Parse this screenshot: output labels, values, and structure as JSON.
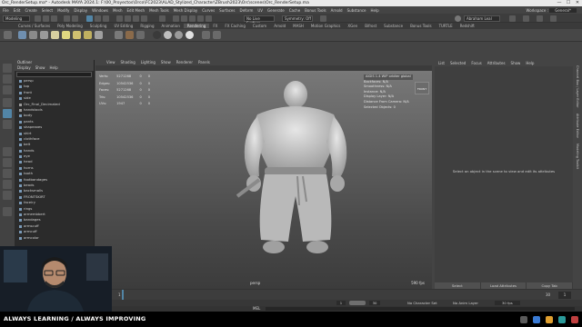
{
  "window": {
    "title": "Orc_RenderSetup.ma* - Autodesk MAYA 2024.1: F:\\00_Proyectos\\Orco\\FC2023\\ALAD_Stylized_Character\\ZBrush2023\\Orc\\scenes\\Orc_RenderSetup.ma",
    "minimize": "—",
    "maximize": "☐",
    "close": "✕"
  },
  "menu": {
    "items": [
      "File",
      "Edit",
      "Create",
      "Select",
      "Modify",
      "Display",
      "Windows",
      "Mesh",
      "Edit Mesh",
      "Mesh Tools",
      "Mesh Display",
      "Curves",
      "Surfaces",
      "Deform",
      "UV",
      "Generate",
      "Cache",
      "Bonus Tools",
      "Arnold",
      "Substance",
      "Help"
    ],
    "workspace_label": "Workspace :",
    "workspace_value": "General*"
  },
  "status_line": {
    "mode": "Modeling",
    "no_live_surface": "No Live Surface",
    "symmetry": "Symmetry: Off",
    "user": "Abraham Leal",
    "signin": "Sign In"
  },
  "shelf": {
    "tabs": [
      "Curves / Surfaces",
      "Poly Modeling",
      "Sculpting",
      "UV Editing",
      "Rigging",
      "Animation",
      "Rendering",
      "FX",
      "FX Caching",
      "Custom",
      "Arnold",
      "MASH",
      "Motion Graphics",
      "XGen",
      "Bifrost",
      "Substance",
      "Bonus Tools",
      "TURTLE",
      "Redshift"
    ],
    "active_tab": "Rendering"
  },
  "outliner": {
    "title": "Outliner",
    "menu": [
      "Display",
      "Show",
      "Help"
    ],
    "search_placeholder": "Search...",
    "items": [
      "persp",
      "top",
      "front",
      "side",
      "Orc_Final_Decimated",
      "handstools",
      "body",
      "pants",
      "shapeaxes",
      "shirt",
      "clothface",
      "belt",
      "hands",
      "eye",
      "head",
      "horns",
      "tooth",
      "footbandages",
      "beads",
      "backsmalls",
      "FRONTSKIRT",
      "faceiry",
      "rings",
      "armembbert",
      "bandages",
      "armscuff",
      "armcuff",
      "armcolor"
    ]
  },
  "viewport": {
    "menu": [
      "View",
      "Shading",
      "Lighting",
      "Show",
      "Renderer",
      "Panels"
    ],
    "hud_left": [
      {
        "label": "Verts:",
        "values": [
          "5271268",
          "0",
          "0"
        ]
      },
      {
        "label": "Edges:",
        "values": [
          "10542536",
          "0",
          "0"
        ]
      },
      {
        "label": "Faces:",
        "values": [
          "5271268",
          "0",
          "0"
        ]
      },
      {
        "label": "Tris:",
        "values": [
          "10542536",
          "0",
          "0"
        ]
      },
      {
        "label": "UVs:",
        "values": [
          "1947",
          "0",
          "0"
        ]
      }
    ],
    "hud_right_header": "AIGIS 1.4 WIP orbiter global",
    "hud_right": [
      {
        "label": "Backfaces:",
        "value": "N/A"
      },
      {
        "label": "Smoothness:",
        "value": "N/A"
      },
      {
        "label": "Instance:",
        "value": "N/A"
      },
      {
        "label": "Display Layer:",
        "value": "N/A"
      },
      {
        "label": "Distance From Camera:",
        "value": "N/A"
      },
      {
        "label": "Selected Objects:",
        "value": "0"
      }
    ],
    "view_cube": "FRONT",
    "camera": "persp",
    "fps": "590 fps"
  },
  "attribute_panel": {
    "tabs": [
      "List",
      "Selected",
      "Focus",
      "Attributes",
      "Show",
      "Help"
    ],
    "message": "Select an object in the scene to view and edit its attributes",
    "buttons": [
      "Select",
      "Load Attributes",
      "Copy Tab"
    ],
    "side_tabs": [
      "Channel Box / Layer Editor",
      "Attribute Editor",
      "Modeling Toolkit"
    ]
  },
  "timeline": {
    "frame_start": "1",
    "frame_end": "30",
    "current_frame": "1",
    "range_start": "1",
    "range_end": "30",
    "no_character_set": "No Character Set",
    "no_anim_layer": "No Anim Layer",
    "fps": "30 fps",
    "mel_label": "MEL"
  },
  "banner": {
    "text": "ALWAYS LEARNING  / ALWAYS IMPROVING"
  },
  "colors": {
    "maya_bg": "#444444",
    "active_tab": "#5a5a5a",
    "selection_blue": "#5285a6",
    "banner_bg": "#000000"
  }
}
